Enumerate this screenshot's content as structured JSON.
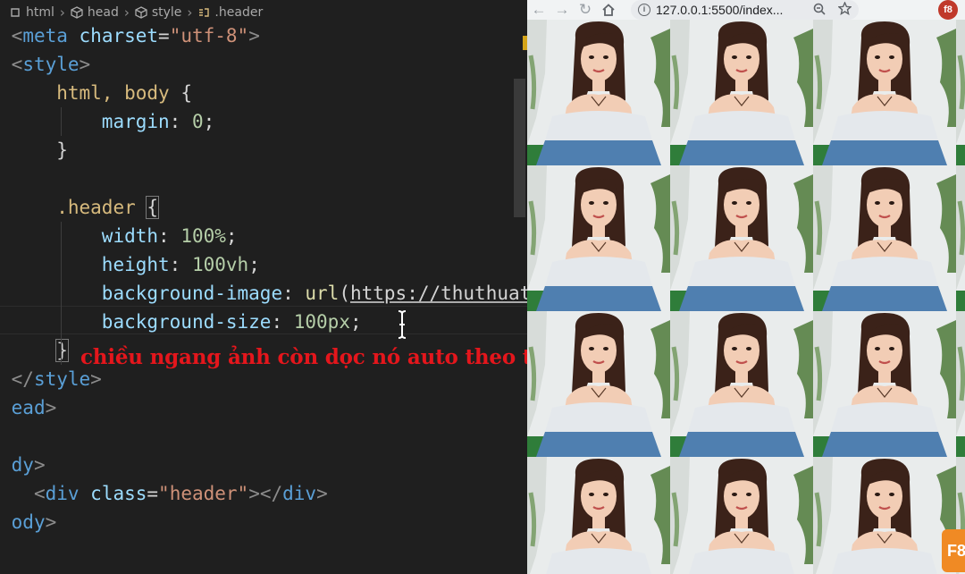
{
  "editor": {
    "breadcrumb": [
      "html",
      "head",
      "style",
      ".header"
    ],
    "lines": [
      [
        {
          "t": "<",
          "c": "t-punc"
        },
        {
          "t": "meta",
          "c": "t-tag"
        },
        {
          "t": " charset",
          "c": "t-attr"
        },
        {
          "t": "=",
          "c": "t-text"
        },
        {
          "t": "\"utf-8\"",
          "c": "t-str"
        },
        {
          "t": ">",
          "c": "t-punc"
        }
      ],
      [
        {
          "t": "<",
          "c": "t-punc"
        },
        {
          "t": "style",
          "c": "t-tag"
        },
        {
          "t": ">",
          "c": "t-punc"
        }
      ],
      [
        {
          "t": "    html, body ",
          "c": "t-sel"
        },
        {
          "t": "{",
          "c": "t-text"
        }
      ],
      [
        {
          "t": "        margin",
          "c": "t-prop"
        },
        {
          "t": ": ",
          "c": "t-text"
        },
        {
          "t": "0",
          "c": "t-num"
        },
        {
          "t": ";",
          "c": "t-text"
        }
      ],
      [
        {
          "t": "    }",
          "c": "t-text"
        }
      ],
      [],
      [
        {
          "t": "    .header ",
          "c": "t-sel"
        },
        {
          "t": "{",
          "c": "t-text brace-box"
        }
      ],
      [
        {
          "t": "        width",
          "c": "t-prop"
        },
        {
          "t": ": ",
          "c": "t-text"
        },
        {
          "t": "100%",
          "c": "t-num"
        },
        {
          "t": ";",
          "c": "t-text"
        }
      ],
      [
        {
          "t": "        height",
          "c": "t-prop"
        },
        {
          "t": ": ",
          "c": "t-text"
        },
        {
          "t": "100vh",
          "c": "t-num"
        },
        {
          "t": ";",
          "c": "t-text"
        }
      ],
      [
        {
          "t": "        background-image",
          "c": "t-prop"
        },
        {
          "t": ": ",
          "c": "t-text"
        },
        {
          "t": "url",
          "c": "t-fn"
        },
        {
          "t": "(",
          "c": "t-text"
        },
        {
          "t": "https://thuthuat",
          "c": "t-url"
        }
      ],
      [
        {
          "t": "        background-size",
          "c": "t-prop"
        },
        {
          "t": ": ",
          "c": "t-text"
        },
        {
          "t": "100px",
          "c": "t-num"
        },
        {
          "t": ";",
          "c": "t-text"
        }
      ],
      [
        {
          "t": "    ",
          "c": "t-text"
        },
        {
          "t": "}",
          "c": "t-text brace-box"
        }
      ],
      [
        {
          "t": "</",
          "c": "t-punc"
        },
        {
          "t": "style",
          "c": "t-tag"
        },
        {
          "t": ">",
          "c": "t-punc"
        }
      ],
      [
        {
          "t": "ead",
          "c": "t-tag"
        },
        {
          "t": ">",
          "c": "t-punc"
        }
      ],
      [],
      [
        {
          "t": "dy",
          "c": "t-tag"
        },
        {
          "t": ">",
          "c": "t-punc"
        }
      ],
      [
        {
          "t": "  <",
          "c": "t-punc"
        },
        {
          "t": "div",
          "c": "t-tag"
        },
        {
          "t": " class",
          "c": "t-attr"
        },
        {
          "t": "=",
          "c": "t-text"
        },
        {
          "t": "\"header\"",
          "c": "t-str"
        },
        {
          "t": "></",
          "c": "t-punc"
        },
        {
          "t": "div",
          "c": "t-tag"
        },
        {
          "t": ">",
          "c": "t-punc"
        }
      ],
      [
        {
          "t": "ody",
          "c": "t-tag"
        },
        {
          "t": ">",
          "c": "t-punc"
        }
      ]
    ],
    "annotation": "chiều ngang ảnh còn dọc nó auto theo tỉ lệ ảnh"
  },
  "browser": {
    "url": "127.0.0.1:5500/index...",
    "tile_rows": 4,
    "tile_cols": 4,
    "watermark": "F8"
  },
  "colors": {
    "editor_bg": "#1f1f1f",
    "annotation": "#e4161c",
    "tile_bg": "#e9ecec",
    "hair": "#3b2219",
    "skin": "#f2cdb5",
    "shirt_top": "#e4e8ec",
    "shirt_bottom": "#4f7fb0"
  }
}
